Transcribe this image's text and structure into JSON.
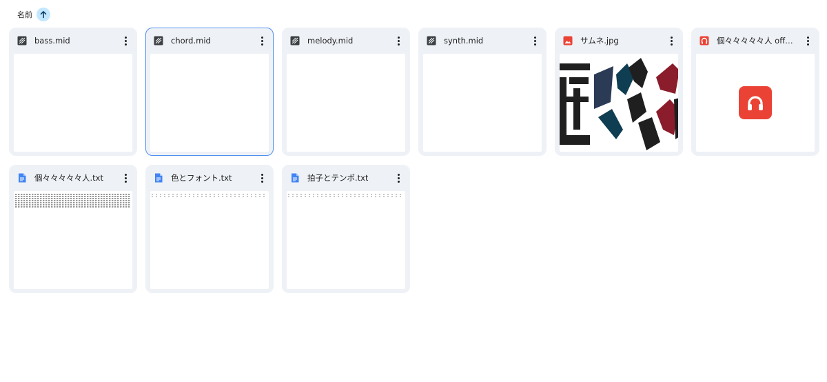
{
  "sort": {
    "label": "名前",
    "direction": "ascending"
  },
  "colors": {
    "card_bg": "#eef1f6",
    "selection": "#4f8ff0",
    "sort_chip": "#c2e7ff",
    "doc_icon": "#4285f4",
    "image_icon": "#ea4335"
  },
  "files": [
    {
      "name": "bass.mid",
      "icon": "midi-file-icon"
    },
    {
      "name": "chord.mid",
      "icon": "midi-file-icon",
      "selected": true
    },
    {
      "name": "melody.mid",
      "icon": "midi-file-icon"
    },
    {
      "name": "synth.mid",
      "icon": "midi-file-icon"
    },
    {
      "name": "サムネ.jpg",
      "icon": "image-file-icon"
    },
    {
      "name": "個々々々々々人 off…",
      "icon": "audio-file-icon"
    },
    {
      "name": "個々々々々々人.txt",
      "icon": "text-document-icon"
    },
    {
      "name": "色とフォント.txt",
      "icon": "text-document-icon"
    },
    {
      "name": "拍子とテンポ.txt",
      "icon": "text-document-icon"
    }
  ]
}
